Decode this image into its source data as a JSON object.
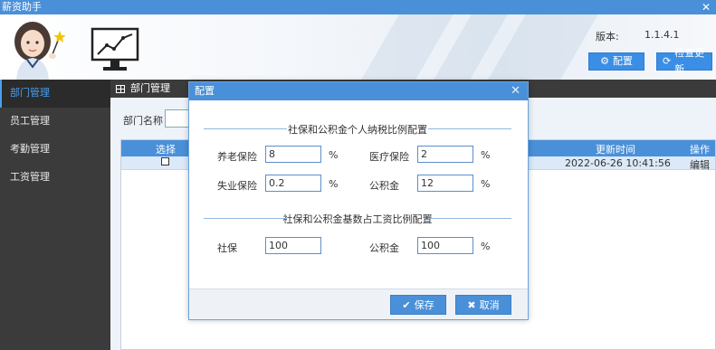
{
  "window": {
    "title": "薪资助手",
    "close": "✕"
  },
  "header": {
    "version_label": "版本:",
    "version_value": "1.1.4.1",
    "config_button": "配置",
    "check_update_button": "检查更新"
  },
  "sidebar": {
    "items": [
      {
        "label": "部门管理",
        "active": true
      },
      {
        "label": "员工管理",
        "active": false
      },
      {
        "label": "考勤管理",
        "active": false
      },
      {
        "label": "工资管理",
        "active": false
      }
    ]
  },
  "main": {
    "tab_title": "部门管理",
    "filter_label": "部门名称",
    "table": {
      "columns": {
        "select": "选择",
        "updated": "更新时间",
        "action": "操作"
      },
      "rows": [
        {
          "updated": "2022-06-26 10:41:56",
          "action": "编辑"
        }
      ]
    }
  },
  "modal": {
    "title": "配置",
    "close": "✕",
    "section1_title": "社保和公积金个人纳税比例配置",
    "section2_title": "社保和公积金基数占工资比例配置",
    "fields": {
      "pension_label": "养老保险",
      "pension_value": "8",
      "medical_label": "医疗保险",
      "medical_value": "2",
      "unemployment_label": "失业保险",
      "unemployment_value": "0.2",
      "housing_label": "公积金",
      "housing_value": "12",
      "social_base_label": "社保",
      "social_base_value": "100",
      "housing_base_label": "公积金",
      "housing_base_value": "100",
      "percent": "%"
    },
    "save_button": "保存",
    "cancel_button": "取消"
  },
  "colors": {
    "accent": "#4a90d9",
    "sidebar": "#3b3b3b",
    "active": "#4a9ff0"
  }
}
